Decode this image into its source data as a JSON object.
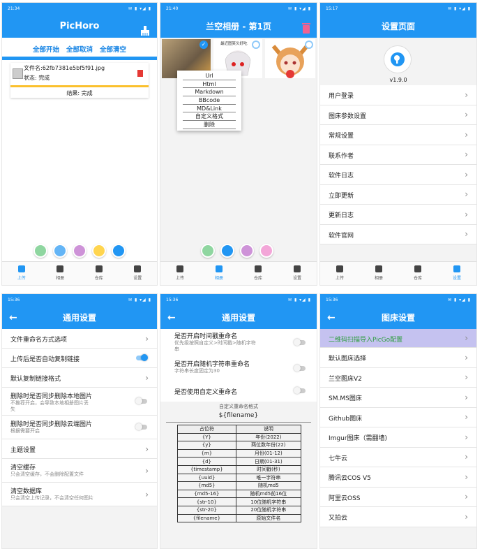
{
  "p1": {
    "time": "21:34",
    "title": "PicHoro",
    "actions": [
      "全部开始",
      "全部取消",
      "全部清空"
    ],
    "file_name": "文件名:62fb7381e5bf5f91.jpg",
    "file_status": "状态: 完成",
    "result": "结果: 完成",
    "fabs": [
      {
        "name": "camera",
        "color": "#8fd6a0"
      },
      {
        "name": "gallery",
        "color": "#64b5f6"
      },
      {
        "name": "paint",
        "color": "#ce93d8"
      },
      {
        "name": "wifi",
        "color": "#ffd54f"
      },
      {
        "name": "menu",
        "color": "#2196f3"
      }
    ],
    "nav": [
      {
        "label": "上传",
        "icon": "upload-icon"
      },
      {
        "label": "相册",
        "icon": "album-icon"
      },
      {
        "label": "仓库",
        "icon": "storage-icon"
      },
      {
        "label": "设置",
        "icon": "settings-icon"
      }
    ]
  },
  "p2": {
    "time": "21:40",
    "title": "兰空相册 - 第1页",
    "img_caption": "最近图笑头好吃",
    "menu": [
      "Url",
      "Html",
      "Markdown",
      "BBcode",
      "MD&Link",
      "自定义格式",
      "删除"
    ],
    "fabs": [
      {
        "name": "code",
        "color": "#8fd6a0"
      },
      {
        "name": "home",
        "color": "#2196f3"
      },
      {
        "name": "copy",
        "color": "#ce93d8"
      },
      {
        "name": "check",
        "color": "#f3a6d8"
      }
    ],
    "nav": [
      {
        "label": "上传",
        "icon": "upload-icon"
      },
      {
        "label": "相册",
        "icon": "album-icon"
      },
      {
        "label": "仓库",
        "icon": "storage-icon"
      },
      {
        "label": "设置",
        "icon": "settings-icon"
      }
    ]
  },
  "p3": {
    "time": "15:17",
    "title": "设置页面",
    "version": "v1.9.0",
    "items": [
      "用户登录",
      "图床参数设置",
      "常规设置",
      "联系作者",
      "软件日志",
      "立即更新",
      "更新日志",
      "软件官网"
    ],
    "nav": [
      {
        "label": "上传",
        "icon": "upload-icon"
      },
      {
        "label": "相册",
        "icon": "album-icon"
      },
      {
        "label": "仓库",
        "icon": "storage-icon"
      },
      {
        "label": "设置",
        "icon": "settings-icon"
      }
    ]
  },
  "p4": {
    "time": "15:36",
    "title": "通用设置",
    "items": [
      {
        "t": "文件重命名方式选项",
        "type": "chev"
      },
      {
        "t": "上传后是否自动复制链接",
        "type": "toggle",
        "on": true
      },
      {
        "t": "默认复制链接格式",
        "type": "chev"
      },
      {
        "t": "删除时是否同步删除本地图片",
        "s": "不推荐开启，会导致本地相册图片丢",
        "s2": "失",
        "type": "toggle",
        "on": false
      },
      {
        "t": "删除时是否同步删除云端图片",
        "s": "根据需要开启",
        "type": "toggle",
        "on": false
      },
      {
        "t": "主题设置",
        "type": "chev"
      },
      {
        "t": "清空缓存",
        "s": "只会清空缓存，不会删除配置文件",
        "type": "chev"
      },
      {
        "t": "清空数据库",
        "s": "只会清空上传记录，不会清空任何图片",
        "type": "chev"
      }
    ]
  },
  "p5": {
    "time": "15:36",
    "title": "通用设置",
    "items": [
      {
        "t": "是否开启时间戳重命名",
        "s": "优先级按照自定义>时间戳>随机字符",
        "s2": "串"
      },
      {
        "t": "是否开启随机字符串重命名",
        "s": "字符串长度固定为30"
      },
      {
        "t": "是否使用自定义重命名"
      }
    ],
    "fmt_label": "自定义重命名格式",
    "fmt_value": "${filename}",
    "table_head": [
      "占位符",
      "说明"
    ],
    "table_rows": [
      [
        "{Y}",
        "年份(2022)"
      ],
      [
        "{y}",
        "两位数年份(22)"
      ],
      [
        "{m}",
        "月份(01-12)"
      ],
      [
        "{d}",
        "日期(01-31)"
      ],
      [
        "{timestamp}",
        "时间戳(秒)"
      ],
      [
        "{uuid}",
        "唯一字符串"
      ],
      [
        "{md5}",
        "随机md5"
      ],
      [
        "{md5-16}",
        "随机md5前16位"
      ],
      [
        "{str-10}",
        "10位随机字符串"
      ],
      [
        "{str-20}",
        "20位随机字符串"
      ],
      [
        "{filename}",
        "原始文件名"
      ]
    ]
  },
  "p6": {
    "time": "15:36",
    "title": "图床设置",
    "highlight": "二维码扫描导入PicGo配置",
    "items": [
      "默认图床选择",
      "兰空图床V2",
      "SM.MS图床",
      "Github图床",
      "Imgur图床（需翻墙)",
      "七牛云",
      "腾讯云COS V5",
      "阿里云OSS",
      "又拍云"
    ]
  },
  "colors": {
    "primary": "#2196f3",
    "highlight": "#c5c2f0",
    "delete": "#e53935",
    "qr_text": "#2e9d3f"
  }
}
